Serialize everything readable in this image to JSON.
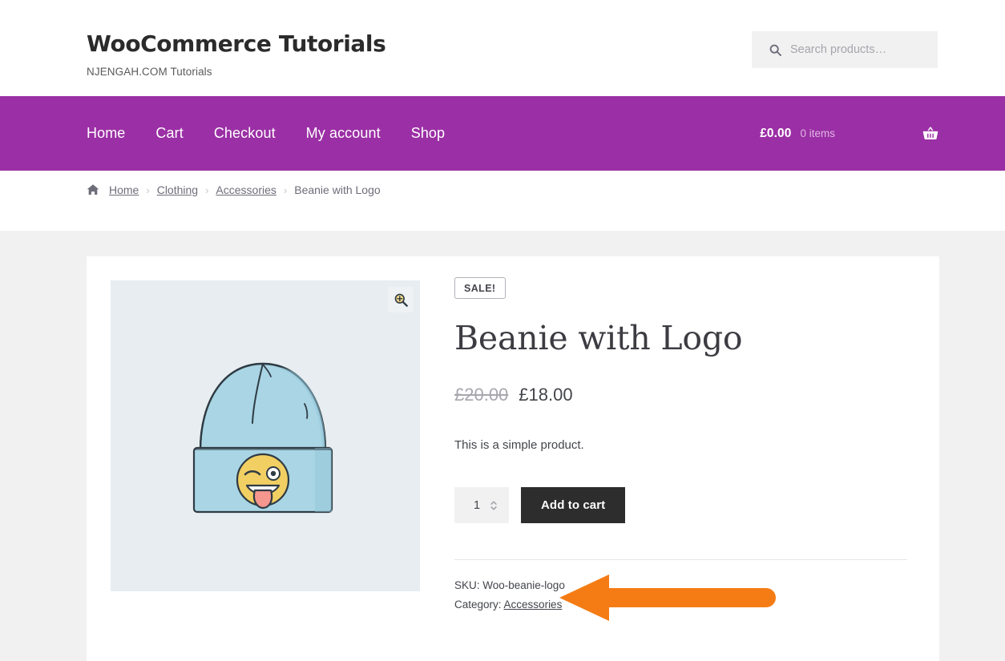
{
  "header": {
    "site_title": "WooCommerce Tutorials",
    "tagline": "NJENGAH.COM Tutorials",
    "search": {
      "icon": "search-icon",
      "placeholder": "Search products…",
      "value": ""
    }
  },
  "nav": {
    "items": [
      {
        "label": "Home"
      },
      {
        "label": "Cart"
      },
      {
        "label": "Checkout"
      },
      {
        "label": "My account"
      },
      {
        "label": "Shop"
      }
    ],
    "cart": {
      "total": "£0.00",
      "count": "0 items",
      "icon": "shopping-basket-icon"
    },
    "background_color": "#9b2fa5"
  },
  "breadcrumb": {
    "home_icon": "home-icon",
    "separator": "›",
    "items": [
      {
        "label": "Home",
        "link": true
      },
      {
        "label": "Clothing",
        "link": true
      },
      {
        "label": "Accessories",
        "link": true
      },
      {
        "label": "Beanie with Logo",
        "link": false
      }
    ]
  },
  "product": {
    "sale_badge": "SALE!",
    "title": "Beanie with Logo",
    "price_old": "£20.00",
    "price_new": "£18.00",
    "description": "This is a simple product.",
    "quantity": "1",
    "add_to_cart_label": "Add to cart",
    "sku_label": "SKU: Woo-beanie-logo",
    "category_label": "Category:",
    "category_value": "Accessories",
    "gallery": {
      "zoom_icon": "magnifier-plus-icon",
      "image_alt": "beanie-product-image",
      "background_color": "#e7edf0",
      "beanie_color": "#a7d3e2",
      "emoji_color": "#f2cf63"
    }
  },
  "annotation": {
    "arrow_icon": "orange-left-arrow",
    "color": "#f57c14"
  }
}
